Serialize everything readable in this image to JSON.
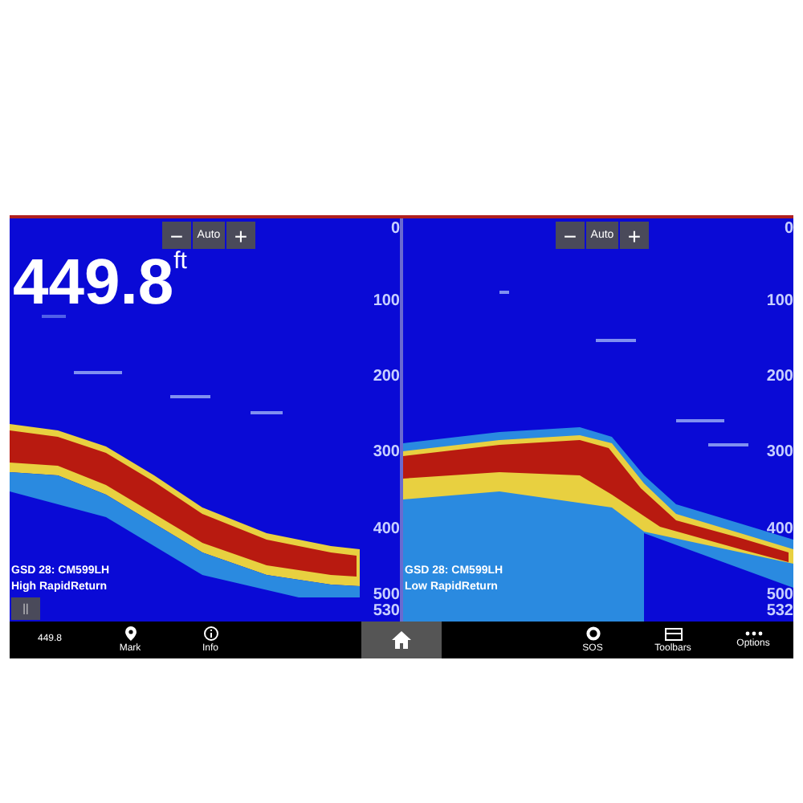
{
  "panels": [
    {
      "zoom": {
        "minus": "−",
        "label": "Auto",
        "plus": "+"
      },
      "depth": {
        "value": "449.8",
        "unit": "ft"
      },
      "scale": [
        "0",
        "100",
        "200",
        "300",
        "400",
        "500",
        "530"
      ],
      "source": "GSD 28: CM599LH",
      "mode": "High RapidReturn",
      "pause": {
        "label": "||"
      }
    },
    {
      "zoom": {
        "minus": "−",
        "label": "Auto",
        "plus": "+"
      },
      "scale": [
        "0",
        "100",
        "200",
        "300",
        "400",
        "500",
        "532"
      ],
      "source": "GSD 28: CM599LH",
      "mode": "Low RapidReturn"
    }
  ],
  "bottom_bar": [
    {
      "kind": "reading",
      "label": "449.8"
    },
    {
      "kind": "button",
      "label": "Mark"
    },
    {
      "kind": "button",
      "label": "Info"
    },
    {
      "kind": "home"
    },
    {
      "kind": "button",
      "label": "SOS"
    },
    {
      "kind": "button",
      "label": "Toolbars"
    },
    {
      "kind": "button",
      "label": "Options"
    }
  ]
}
